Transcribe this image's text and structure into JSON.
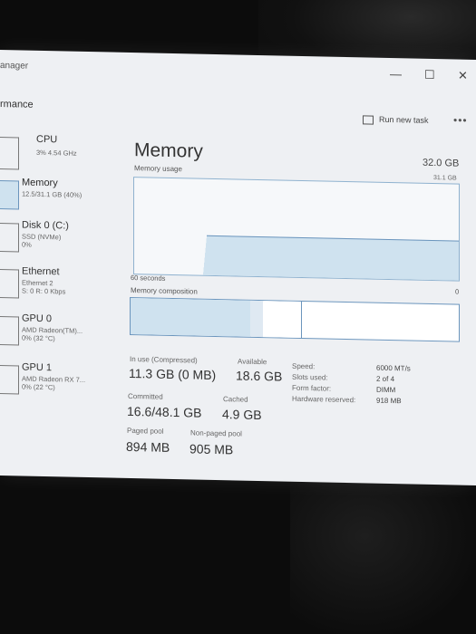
{
  "window": {
    "title_partial": "anager",
    "section_partial": "rmance",
    "run_new_task": "Run new task",
    "more": "•••",
    "min": "—",
    "max": "☐",
    "close": "✕"
  },
  "sidebar": {
    "items": [
      {
        "name": "CPU",
        "sub1": "3% 4.54 GHz",
        "sub2": ""
      },
      {
        "name": "Memory",
        "sub1": "12.5/31.1 GB (40%)",
        "sub2": ""
      },
      {
        "name": "Disk 0 (C:)",
        "sub1": "SSD (NVMe)",
        "sub2": "0%"
      },
      {
        "name": "Ethernet",
        "sub1": "Ethernet 2",
        "sub2": "S: 0 R: 0 Kbps"
      },
      {
        "name": "GPU 0",
        "sub1": "AMD Radeon(TM)...",
        "sub2": "0% (32 °C)"
      },
      {
        "name": "GPU 1",
        "sub1": "AMD Radeon RX 7...",
        "sub2": "0% (22 °C)"
      }
    ]
  },
  "memory": {
    "title": "Memory",
    "total": "32.0 GB",
    "usage_label": "Memory usage",
    "usage_max": "31.1 GB",
    "time_label": "60 seconds",
    "zero_label": "0",
    "composition_label": "Memory composition",
    "stats": {
      "in_use_label": "In use (Compressed)",
      "in_use_value": "11.3 GB (0 MB)",
      "available_label": "Available",
      "available_value": "18.6 GB",
      "committed_label": "Committed",
      "committed_value": "16.6/48.1 GB",
      "cached_label": "Cached",
      "cached_value": "4.9 GB",
      "paged_label": "Paged pool",
      "paged_value": "894 MB",
      "nonpaged_label": "Non-paged pool",
      "nonpaged_value": "905 MB"
    },
    "specs": {
      "speed_label": "Speed:",
      "speed_value": "6000 MT/s",
      "slots_label": "Slots used:",
      "slots_value": "2 of 4",
      "form_label": "Form factor:",
      "form_value": "DIMM",
      "reserved_label": "Hardware reserved:",
      "reserved_value": "918 MB"
    }
  },
  "colors": {
    "graph_fill": "#cfe2ef",
    "graph_stroke": "#6b95bd",
    "window_bg": "#eef0f3"
  }
}
